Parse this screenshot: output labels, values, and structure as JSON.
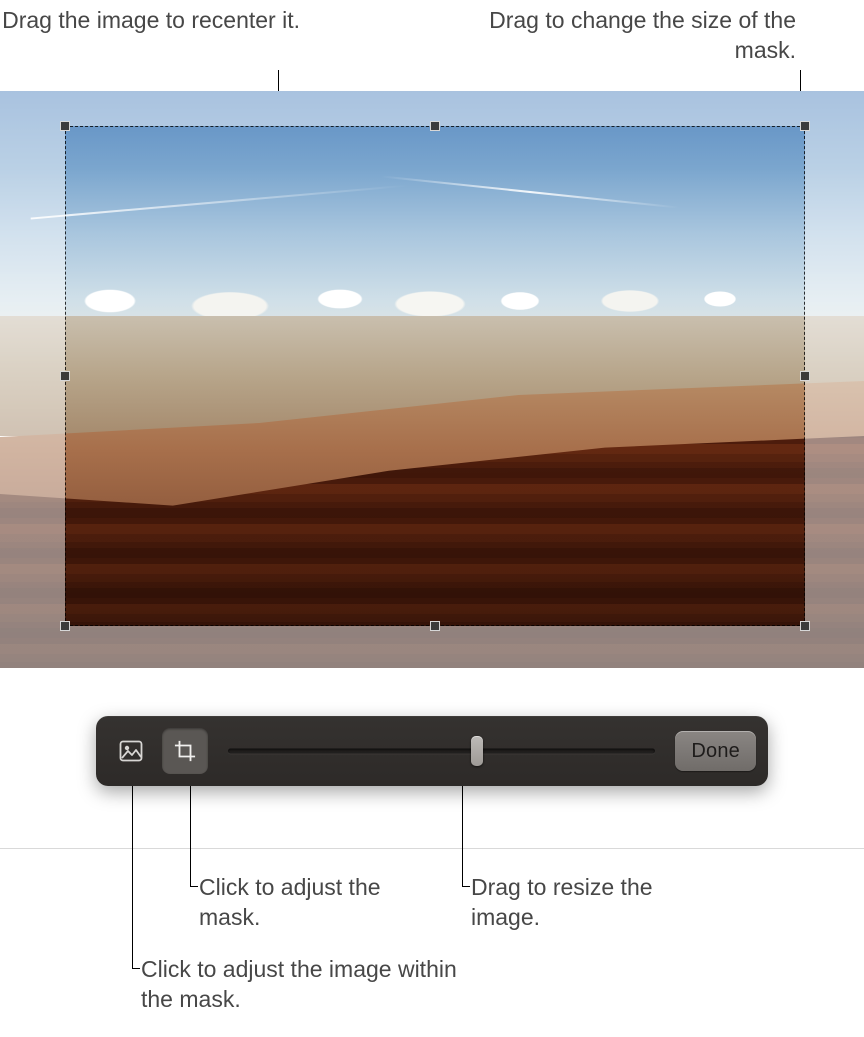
{
  "callouts": {
    "recenter": "Drag the image to recenter it.",
    "resize_mask": "Drag to change the size of the mask.",
    "adjust_mask": "Click to adjust the mask.",
    "resize_image": "Drag to resize the image.",
    "adjust_image": "Click to adjust the image within the mask."
  },
  "toolbar": {
    "image_mode_icon": "image-icon",
    "mask_mode_icon": "crop-icon",
    "done_label": "Done",
    "slider": {
      "min": 0,
      "max": 100,
      "value": 58
    },
    "active_mode": "mask"
  }
}
